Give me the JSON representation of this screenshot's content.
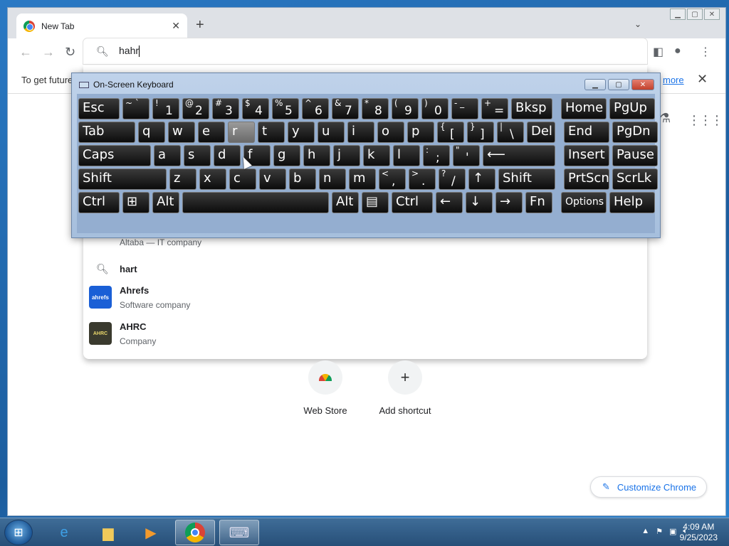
{
  "browser": {
    "tab_title": "New Tab",
    "tab_close": "✕",
    "new_tab": "+",
    "tab_menu": "⌄",
    "omnibox_value": "hahr",
    "infobar_text": "To get future",
    "infobar_link": "more",
    "infobar_close": "✕"
  },
  "suggestions": [
    {
      "title": "",
      "subtitle": "Altaba — IT company"
    },
    {
      "title": "hart",
      "subtitle": ""
    },
    {
      "title": "Ahrefs",
      "subtitle": "Software company",
      "logo": "ahrefs"
    },
    {
      "title": "AHRC",
      "subtitle": "Company",
      "logo": "AHRC"
    }
  ],
  "shortcuts": [
    {
      "label": "Web Store"
    },
    {
      "label": "Add shortcut",
      "icon": "+"
    }
  ],
  "customize_label": "Customize Chrome",
  "osk": {
    "title": "On-Screen Keyboard",
    "rows": [
      [
        {
          "main": "Esc",
          "w": 58
        },
        {
          "shift": "~ `",
          "main": "",
          "w": 38
        },
        {
          "shift": "!",
          "main": "1",
          "w": 38
        },
        {
          "shift": "@",
          "main": "2",
          "w": 38
        },
        {
          "shift": "#",
          "main": "3",
          "w": 38
        },
        {
          "shift": "$",
          "main": "4",
          "w": 38
        },
        {
          "shift": "%",
          "main": "5",
          "w": 38
        },
        {
          "shift": "^",
          "main": "6",
          "w": 38
        },
        {
          "shift": "&",
          "main": "7",
          "w": 38
        },
        {
          "shift": "*",
          "main": "8",
          "w": 38
        },
        {
          "shift": "(",
          "main": "9",
          "w": 38
        },
        {
          "shift": ")",
          "main": "0",
          "w": 38
        },
        {
          "shift": "- _",
          "main": "",
          "w": 38
        },
        {
          "shift": "+",
          "main": "=",
          "w": 38
        },
        {
          "main": "Bksp",
          "w": 58
        },
        {
          "main": "Home",
          "w": 64,
          "gap": 8
        },
        {
          "main": "PgUp",
          "w": 64
        }
      ],
      [
        {
          "main": "Tab",
          "w": 80
        },
        {
          "main": "q",
          "w": 38
        },
        {
          "main": "w",
          "w": 38
        },
        {
          "main": "e",
          "w": 38
        },
        {
          "main": "r",
          "w": 38,
          "hl": true
        },
        {
          "main": "t",
          "w": 38
        },
        {
          "main": "y",
          "w": 38
        },
        {
          "main": "u",
          "w": 38
        },
        {
          "main": "i",
          "w": 38
        },
        {
          "main": "o",
          "w": 38
        },
        {
          "main": "p",
          "w": 38
        },
        {
          "shift": "{",
          "main": "[",
          "w": 38
        },
        {
          "shift": "}",
          "main": "]",
          "w": 38
        },
        {
          "shift": "|",
          "main": "\\",
          "w": 38
        },
        {
          "main": "Del",
          "w": 40
        },
        {
          "main": "End",
          "w": 64,
          "gap": 8
        },
        {
          "main": "PgDn",
          "w": 64
        }
      ],
      [
        {
          "main": "Caps",
          "w": 102
        },
        {
          "main": "a",
          "w": 38
        },
        {
          "main": "s",
          "w": 38
        },
        {
          "main": "d",
          "w": 38
        },
        {
          "main": "f",
          "w": 38
        },
        {
          "main": "g",
          "w": 38
        },
        {
          "main": "h",
          "w": 38
        },
        {
          "main": "j",
          "w": 38
        },
        {
          "main": "k",
          "w": 38
        },
        {
          "main": "l",
          "w": 38
        },
        {
          "shift": ":",
          "main": ";",
          "w": 38
        },
        {
          "shift": "\"",
          "main": "'",
          "w": 38
        },
        {
          "main": "⟵",
          "w": 102
        },
        {
          "main": "Insert",
          "w": 64,
          "gap": 8
        },
        {
          "main": "Pause",
          "w": 64
        }
      ],
      [
        {
          "main": "Shift",
          "w": 124
        },
        {
          "main": "z",
          "w": 38
        },
        {
          "main": "x",
          "w": 38
        },
        {
          "main": "c",
          "w": 38
        },
        {
          "main": "v",
          "w": 38
        },
        {
          "main": "b",
          "w": 38
        },
        {
          "main": "n",
          "w": 38
        },
        {
          "main": "m",
          "w": 38
        },
        {
          "shift": "<",
          "main": ",",
          "w": 38
        },
        {
          "shift": ">",
          "main": ".",
          "w": 38
        },
        {
          "shift": "?",
          "main": "/",
          "w": 38
        },
        {
          "main": "↑",
          "w": 38
        },
        {
          "main": "Shift",
          "w": 80
        },
        {
          "main": "PrtScn",
          "w": 64,
          "gap": 8
        },
        {
          "main": "ScrLk",
          "w": 64
        }
      ],
      [
        {
          "main": "Ctrl",
          "w": 58
        },
        {
          "main": "⊞",
          "w": 38
        },
        {
          "main": "Alt",
          "w": 38
        },
        {
          "main": "",
          "w": 206
        },
        {
          "main": "Alt",
          "w": 38
        },
        {
          "main": "▤",
          "w": 38
        },
        {
          "main": "Ctrl",
          "w": 58
        },
        {
          "main": "←",
          "w": 38
        },
        {
          "main": "↓",
          "w": 38
        },
        {
          "main": "→",
          "w": 38
        },
        {
          "main": "Fn",
          "w": 38
        },
        {
          "main": "Options",
          "w": 64,
          "gap": 8,
          "small": true
        },
        {
          "main": "Help",
          "w": 64
        }
      ]
    ]
  },
  "taskbar": {
    "time": "4:09 AM",
    "date": "9/25/2023"
  }
}
